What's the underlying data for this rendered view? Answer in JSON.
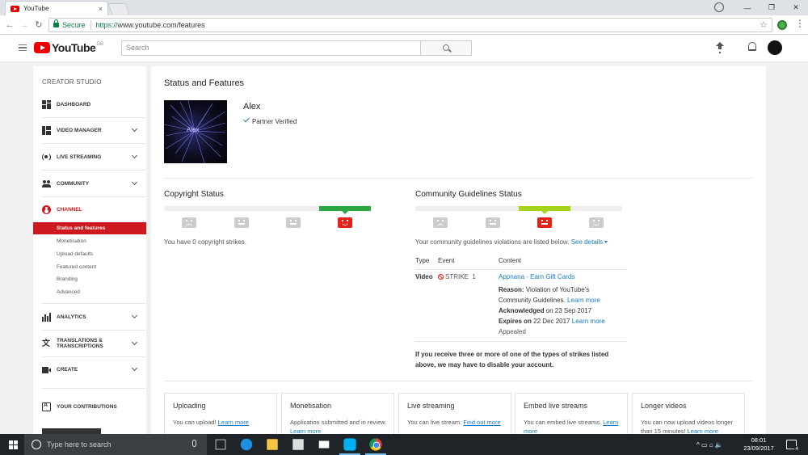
{
  "browser": {
    "tab_title": "YouTube",
    "tab_close": "×",
    "secure_label": "Secure",
    "url_scheme": "https://",
    "url_rest": "www.youtube.com/features",
    "window_controls": [
      "—",
      "❐",
      "✕"
    ]
  },
  "masthead": {
    "logo_text": "YouTube",
    "region": "GB",
    "search_placeholder": "Search"
  },
  "sidebar": {
    "title": "CREATOR STUDIO",
    "items": [
      {
        "label": "DASHBOARD"
      },
      {
        "label": "VIDEO MANAGER"
      },
      {
        "label": "LIVE STREAMING"
      },
      {
        "label": "COMMUNITY"
      },
      {
        "label": "CHANNEL"
      },
      {
        "label": "ANALYTICS"
      },
      {
        "label": "TRANSLATIONS & TRANSCRIPTIONS"
      },
      {
        "label": "CREATE"
      },
      {
        "label": "YOUR CONTRIBUTIONS"
      }
    ],
    "channel_subitems": [
      "Status and features",
      "Monetisation",
      "Upload defaults",
      "Featured content",
      "Branding",
      "Advanced"
    ]
  },
  "main": {
    "page_title": "Status and Features",
    "channel_name": "Alex",
    "thumb_label": "Alex",
    "verified_label": "Partner Verified",
    "copyright": {
      "title": "Copyright Status",
      "text": "You have 0 copyright strikes."
    },
    "community": {
      "title": "Community Guidelines Status",
      "text": "Your community guidelines violations are listed below.",
      "see_details": "See details",
      "table_headers": [
        "Type",
        "Event",
        "Content"
      ],
      "row": {
        "type": "Video",
        "event": "STRIKE",
        "count": "1",
        "content_link": "Appnana - Earn Gift Cards",
        "reason_label": "Reason:",
        "reason_text": "Violation of YouTube's Community Guidelines.",
        "learn_more": "Learn more",
        "acknowledged_label": "Acknowledged",
        "acknowledged_text": "on 23 Sep 2017",
        "expires_label": "Expires on",
        "expires_text": "22 Dec 2017",
        "status": "Appealed"
      },
      "warning": "If you receive three or more of one of the types of strikes listed above, we may have to disable your account."
    },
    "feature_cards": [
      {
        "title": "Uploading",
        "text": "You can upload!",
        "link": "Learn more"
      },
      {
        "title": "Monetisation",
        "text": "Application submitted and in review.",
        "link": "Learn more"
      },
      {
        "title": "Live streaming",
        "text": "You can live stream.",
        "link": "Find out more"
      },
      {
        "title": "Embed live streams",
        "text": "You can embed live streams.",
        "link": "Learn more"
      },
      {
        "title": "Longer videos",
        "text": "You can now upload videos longer than 15 minutes!",
        "link": "Learn more"
      }
    ]
  },
  "taskbar": {
    "search_placeholder": "Type here to search",
    "time": "08:01",
    "date": "23/09/2017",
    "notification_count": "4",
    "tray": "^ ▭ ⌂ 🔈"
  },
  "colors": {
    "youtube_red": "#e00000",
    "studio_red": "#cc181e",
    "link_blue": "#167ac6",
    "strike_green": "#2ba640",
    "strike_lime": "#a3d31a"
  }
}
